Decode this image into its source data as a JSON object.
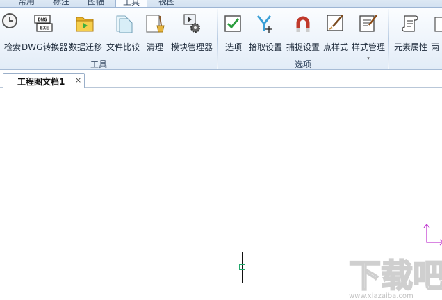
{
  "menu": {
    "tabs": [
      "常用",
      "标注",
      "图幅",
      "工具",
      "视图"
    ],
    "active_tab": "工具"
  },
  "ribbon": {
    "groups": [
      {
        "label": "工具",
        "buttons": [
          "检索",
          "DWG转换器",
          "数据迁移",
          "文件比较",
          "清理",
          "模块管理器"
        ]
      },
      {
        "label": "选项",
        "buttons": [
          "选项",
          "拾取设置",
          "捕捉设置",
          "点样式",
          "样式管理"
        ]
      },
      {
        "label": "",
        "buttons": [
          "元素属性",
          "两"
        ]
      }
    ],
    "dropdown_arrow": "▾",
    "dwg_icon_text": [
      "DWG",
      "EXE"
    ]
  },
  "document": {
    "tab_title": "工程图文档1",
    "close_glyph": "×"
  },
  "colors": {
    "ribbon_top": "#fbfdff",
    "ribbon_bottom": "#e2ecf7",
    "accent_green": "#22a86b",
    "ucs_magenta": "#c23fd1"
  },
  "watermark": {
    "text": "下载吧",
    "url": "www.xiazaiba.com"
  }
}
